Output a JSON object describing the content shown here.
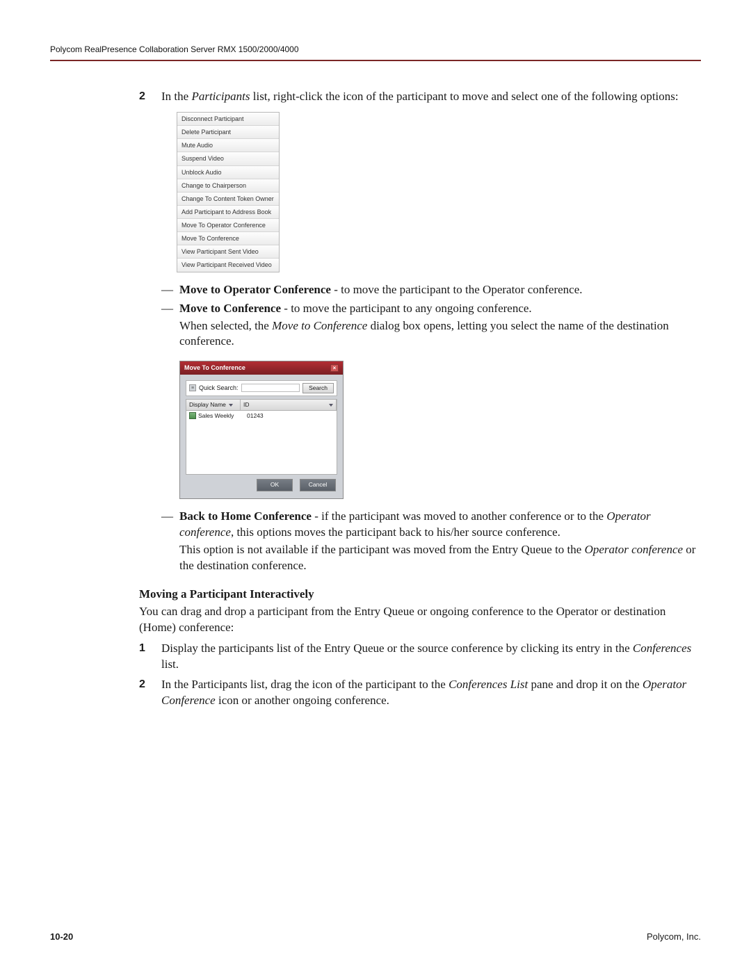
{
  "header": {
    "title": "Polycom RealPresence Collaboration Server RMX 1500/2000/4000"
  },
  "step2": {
    "num": "2",
    "text_a": "In the ",
    "text_em": "Participants",
    "text_b": " list, right-click the icon of the participant to move and select one of the following options:"
  },
  "menu": [
    "Disconnect Participant",
    "Delete Participant",
    "Mute Audio",
    "Suspend Video",
    "Unblock Audio",
    "Change to Chairperson",
    "Change To Content Token Owner",
    "Add Participant to Address Book",
    "Move To Operator Conference",
    "Move To Conference",
    "View Participant Sent Video",
    "View Participant Received Video"
  ],
  "bullets": [
    {
      "bold": "Move to Operator Conference",
      "rest": " - to move the participant to the Operator conference."
    },
    {
      "bold": "Move to Conference",
      "rest": " - to move the participant to any ongoing conference.",
      "sub_a": "When selected, the ",
      "sub_em": "Move to Conference",
      "sub_b": " dialog box opens, letting you select the name of the destination conference."
    },
    {
      "bold": "Back to Home Conference",
      "rest_a": " - if the participant was moved to another conference or to the ",
      "rest_em": "Operator conference",
      "rest_b": ", this options moves the participant back to his/her source conference.",
      "sub2_a": "This option is not available if the participant was moved from the Entry Queue to the ",
      "sub2_em": "Operator conference",
      "sub2_b": " or the destination conference."
    }
  ],
  "dialog": {
    "title": "Move To Conference",
    "quick_search_label": "Quick Search:",
    "search_btn": "Search",
    "col_name": "Display Name",
    "col_id": "ID",
    "row_name": "Sales Weekly",
    "row_id": "01243",
    "ok": "OK",
    "cancel": "Cancel"
  },
  "section": {
    "heading": "Moving a Participant Interactively",
    "intro": "You can drag and drop a participant from the Entry Queue or ongoing conference to the Operator or destination (Home) conference:",
    "step1_num": "1",
    "step1_a": "Display the participants list of the Entry Queue or the source conference by clicking its entry in the ",
    "step1_em": "Conferences",
    "step1_b": " list.",
    "step2_num": "2",
    "step2_a": "In the Participants list, drag the icon of the participant to the ",
    "step2_em1": "Conferences List",
    "step2_b": " pane and drop it on the ",
    "step2_em2": "Operator Conference",
    "step2_c": " icon or another ongoing conference."
  },
  "footer": {
    "page": "10-20",
    "company": "Polycom, Inc."
  }
}
